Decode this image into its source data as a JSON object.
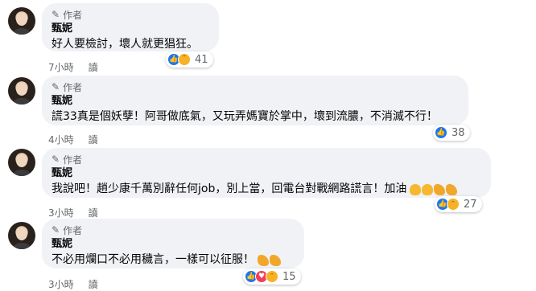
{
  "comments": [
    {
      "badge": "作者",
      "name": "甄妮",
      "text": "好人要檢討，壞人就更猖狂。",
      "time": "7小時",
      "reply": "讀",
      "reaction_count": "41",
      "reactions": [
        "like-icon",
        "sad-icon"
      ]
    },
    {
      "badge": "作者",
      "name": "甄妮",
      "text": "謊33真是個妖孽！阿哥做底氣，又玩弄媽寶於掌中，壞到流膿，不消滅不行！",
      "time": "4小時",
      "reply": "讀",
      "reaction_count": "38",
      "reactions": [
        "like-icon"
      ]
    },
    {
      "badge": "作者",
      "name": "甄妮",
      "text": "我說吧！趙少康千萬別辭任何job，別上當，回電台對戰網路謊言！加油",
      "time": "3小時",
      "reply": "讀",
      "reaction_count": "27",
      "reactions": [
        "like-icon",
        "haha-icon"
      ]
    },
    {
      "badge": "作者",
      "name": "甄妮",
      "text": "不必用爛口不必用穢言，一樣可以征服！",
      "time": "3小時",
      "reply": "讀",
      "reaction_count": "15",
      "reactions": [
        "like-icon",
        "love-icon",
        "haha-icon"
      ]
    }
  ],
  "colors": {
    "bubble": "#f0f2f5",
    "like": "#1877f2",
    "love": "#f33e58",
    "emoji": "#f7b125",
    "meta_text": "#65676b"
  }
}
